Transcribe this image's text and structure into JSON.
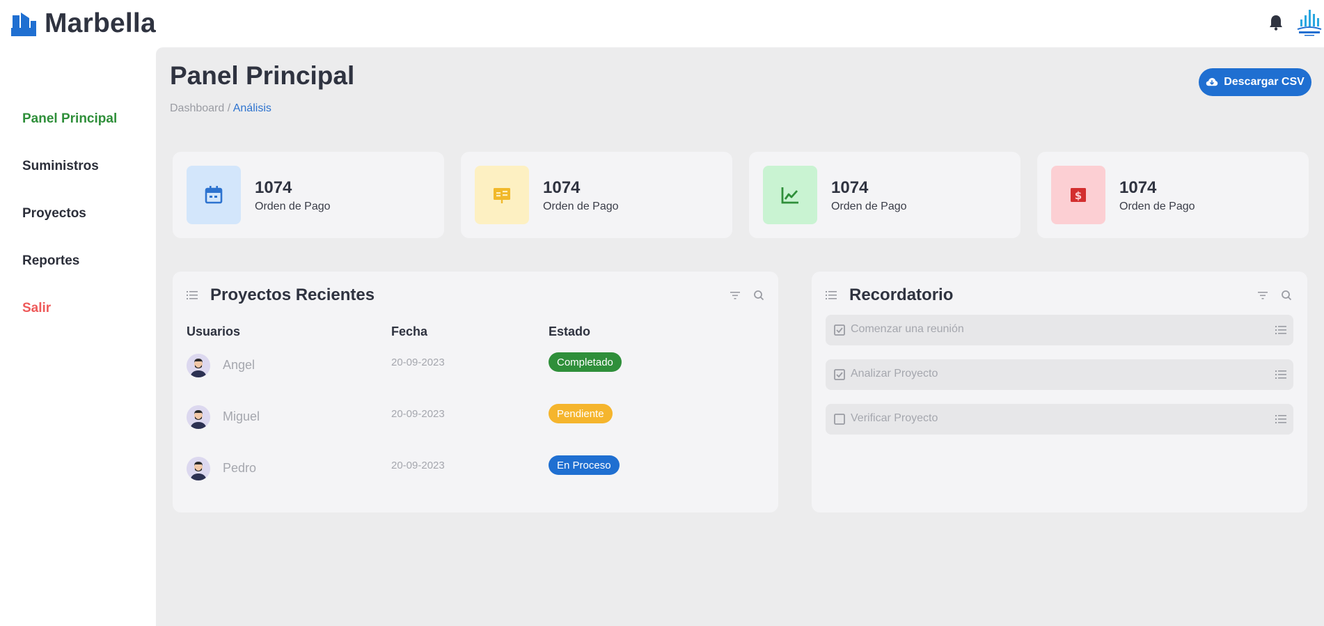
{
  "app": {
    "brand": "Marbella"
  },
  "sidebar": {
    "items": [
      {
        "label": "Panel Principal"
      },
      {
        "label": "Suministros"
      },
      {
        "label": "Proyectos"
      },
      {
        "label": "Reportes"
      },
      {
        "label": "Salir"
      }
    ]
  },
  "header": {
    "title": "Panel Principal",
    "breadcrumb": {
      "root": "Dashboard",
      "separator": " / ",
      "current": "Análisis"
    },
    "csv_button": "Descargar CSV"
  },
  "stats": [
    {
      "value": "1074",
      "label": "Orden de Pago",
      "icon": "calendar-icon",
      "bg": "#d3e6fb",
      "fg": "#2d73cf"
    },
    {
      "value": "1074",
      "label": "Orden de Pago",
      "icon": "presentation-icon",
      "bg": "#fdf0c2",
      "fg": "#f1b92b"
    },
    {
      "value": "1074",
      "label": "Orden de Pago",
      "icon": "line-chart-icon",
      "bg": "#c9f3d2",
      "fg": "#2f8f3a"
    },
    {
      "value": "1074",
      "label": "Orden de Pago",
      "icon": "money-icon",
      "bg": "#fccfd3",
      "fg": "#d32f2f"
    }
  ],
  "projects": {
    "title": "Proyectos Recientes",
    "columns": [
      "Usuarios",
      "Fecha",
      "Estado"
    ],
    "rows": [
      {
        "user": "Angel",
        "date": "20-09-2023",
        "status": "Completado",
        "status_color": "#2f8f3a"
      },
      {
        "user": "Miguel",
        "date": "20-09-2023",
        "status": "Pendiente",
        "status_color": "#f5b52d"
      },
      {
        "user": "Pedro",
        "date": "20-09-2023",
        "status": "En Proceso",
        "status_color": "#1f6fd1"
      }
    ]
  },
  "reminders": {
    "title": "Recordatorio",
    "items": [
      {
        "text": "Comenzar una reunión",
        "checked": true
      },
      {
        "text": "Analizar Proyecto",
        "checked": true
      },
      {
        "text": "Verificar Proyecto",
        "checked": false
      }
    ]
  },
  "colors": {
    "accent": "#1f6fd1",
    "active_nav": "#2f8f3a",
    "danger": "#ee5a5a"
  }
}
